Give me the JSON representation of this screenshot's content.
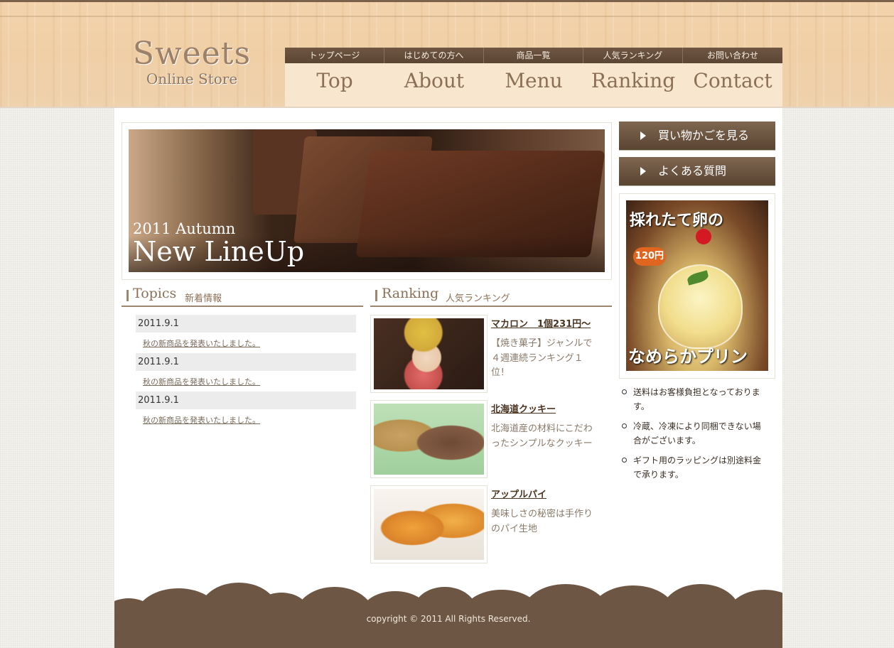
{
  "logo": {
    "line1": "Sweets",
    "line2": "Online Store"
  },
  "nav": [
    {
      "jp": "トップページ",
      "en": "Top"
    },
    {
      "jp": "はじめての方へ",
      "en": "About"
    },
    {
      "jp": "商品一覧",
      "en": "Menu"
    },
    {
      "jp": "人気ランキング",
      "en": "Ranking"
    },
    {
      "jp": "お問い合わせ",
      "en": "Contact"
    }
  ],
  "hero": {
    "line1": "2011 Autumn",
    "line2": "New LineUp"
  },
  "topics": {
    "title_en": "Topics",
    "title_jp": "新着情報",
    "items": [
      {
        "date": "2011.9.1",
        "text": "秋の新商品を発表いたしました。"
      },
      {
        "date": "2011.9.1",
        "text": "秋の新商品を発表いたしました。"
      },
      {
        "date": "2011.9.1",
        "text": "秋の新商品を発表いたしました。"
      }
    ]
  },
  "ranking": {
    "title_en": "Ranking",
    "title_jp": "人気ランキング",
    "items": [
      {
        "name": "マカロン　1個231円〜",
        "desc": "【焼き菓子】ジャンルで４週連続ランキング１位！"
      },
      {
        "name": "北海道クッキー",
        "desc": "北海道産の材料にこだわったシンプルなクッキー"
      },
      {
        "name": "アップルパイ",
        "desc": "美味しさの秘密は手作りのパイ生地"
      }
    ]
  },
  "sidebar": {
    "cart_button": "買い物かごを見る",
    "faq_button": "よくある質問",
    "banner": {
      "line1": "採れたて卵の",
      "price": "120円",
      "line2": "なめらかプリン"
    },
    "notes": [
      "送料はお客様負担となっております。",
      "冷蔵、冷凍により同梱できない場合がございます。",
      "ギフト用のラッピングは別途料金で承ります。"
    ]
  },
  "footer": {
    "copyright": "copyright © 2011 All Rights Reserved."
  }
}
